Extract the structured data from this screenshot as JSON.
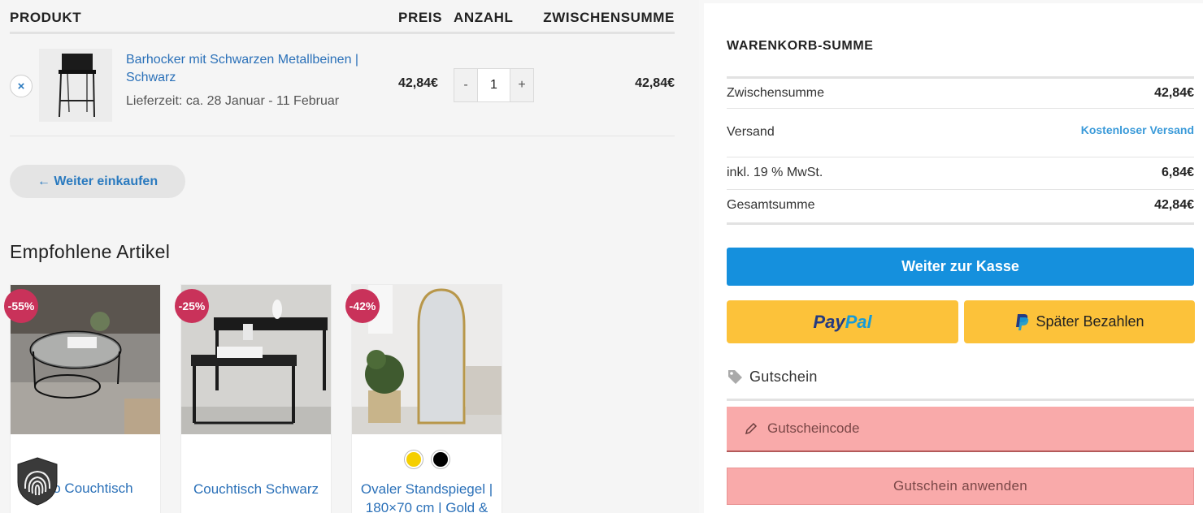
{
  "cart": {
    "headers": {
      "product": "PRODUKT",
      "price": "PREIS",
      "quantity": "ANZAHL",
      "subtotal": "ZWISCHENSUMME"
    },
    "item": {
      "remove": "×",
      "name": "Barhocker mit Schwarzen Metallbeinen | Schwarz",
      "delivery": "Lieferzeit: ca. 28 Januar - 11 Februar",
      "price": "42,84€",
      "quantity": "1",
      "minus": "-",
      "plus": "+",
      "subtotal": "42,84€"
    },
    "continue_label": "← Weiter einkaufen"
  },
  "recommended": {
    "title": "Empfohlene Artikel",
    "cards": [
      {
        "badge": "-55%",
        "name": "Brio Couchtisch"
      },
      {
        "badge": "-25%",
        "name": "Couchtisch Schwarz"
      },
      {
        "badge": "-42%",
        "name": "Ovaler Standspiegel | 180×70 cm | Gold &"
      }
    ],
    "swatches": [
      "#f5cf00",
      "#000000"
    ]
  },
  "summary": {
    "title": "WARENKORB-SUMME",
    "rows": [
      {
        "label": "Zwischensumme",
        "value": "42,84€"
      },
      {
        "label": "Versand",
        "value": "Kostenloser Versand"
      },
      {
        "label": "inkl. 19 % MwSt.",
        "value": "6,84€"
      },
      {
        "label": "Gesamtsumme",
        "value": "42,84€"
      }
    ],
    "checkout_label": "Weiter zur Kasse",
    "paypal": {
      "part1": "Pay",
      "part2": "Pal"
    },
    "paylater_label": "Später Bezahlen"
  },
  "coupon": {
    "heading": "Gutschein",
    "placeholder": "Gutscheincode",
    "apply_label": "Gutschein anwenden"
  },
  "colors": {
    "accent": "#1590dd",
    "link": "#2a70b8",
    "badge": "#c9325a",
    "paypal_yellow": "#fcc23a",
    "coupon_bg": "#f9aaaa"
  }
}
